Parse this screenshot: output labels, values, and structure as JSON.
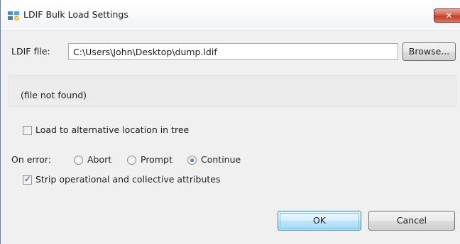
{
  "window": {
    "title": "LDIF Bulk Load Settings",
    "close_label": "✕"
  },
  "file": {
    "label": "LDIF file:",
    "value": "C:\\Users\\John\\Desktop\\dump.ldif",
    "browse_label": "Browse..."
  },
  "status": {
    "message": "(file not found)"
  },
  "options": {
    "alt_location": {
      "label": "Load to alternative location in tree",
      "checked": false
    },
    "on_error": {
      "label": "On error:",
      "choices": [
        "Abort",
        "Prompt",
        "Continue"
      ],
      "selected": "Continue"
    },
    "strip_attrs": {
      "label": "Strip operational and collective attributes",
      "checked": true
    }
  },
  "buttons": {
    "ok_label": "OK",
    "cancel_label": "Cancel"
  },
  "icons": {
    "app": "ldif-app-icon",
    "close": "close-icon",
    "check": "checkmark-icon"
  },
  "colors": {
    "close_button": "#c23f27",
    "ok_border": "#3c7fb1",
    "window_bg": "#f0f0f0"
  }
}
